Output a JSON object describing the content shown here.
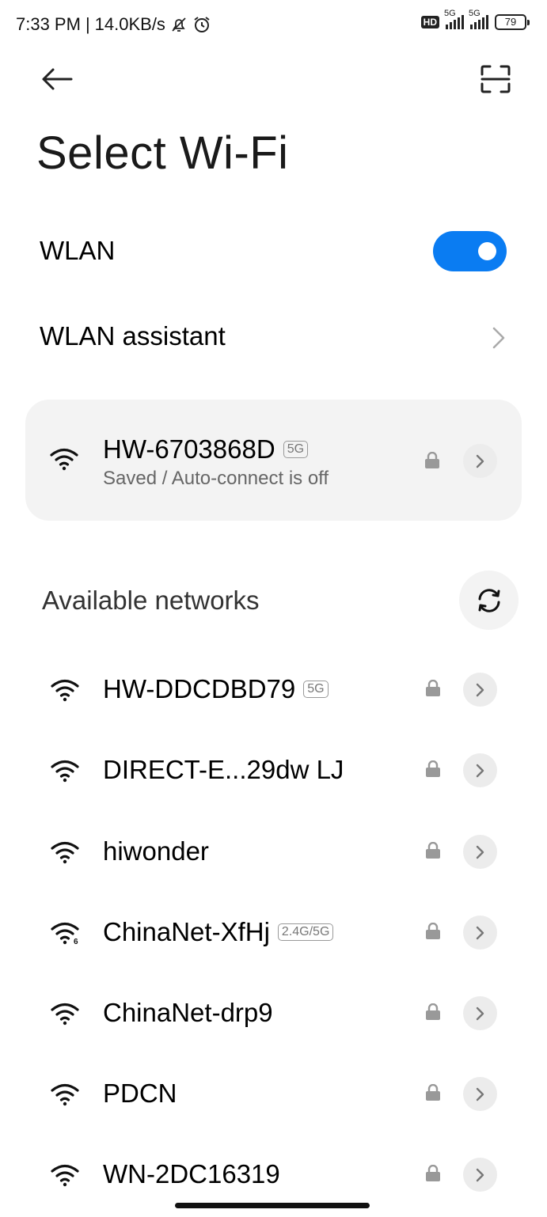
{
  "status_bar": {
    "time": "7:33 PM",
    "speed": "14.0KB/s",
    "hd_label": "HD",
    "sim1_tag": "5G",
    "sim2_tag": "5G",
    "battery": "79"
  },
  "header": {
    "title": "Select Wi-Fi",
    "back_icon": "arrow-left-icon",
    "scan_icon": "scan-qr-icon"
  },
  "wlan": {
    "label": "WLAN",
    "enabled": true,
    "accent_color": "#0a7cf2"
  },
  "assistant": {
    "label": "WLAN assistant"
  },
  "saved_network": {
    "ssid": "HW-6703868D",
    "band": "5G",
    "status": "Saved / Auto-connect is off"
  },
  "available": {
    "label": "Available networks",
    "networks": [
      {
        "ssid": "HW-DDCDBD79",
        "band": "5G",
        "wifi6": false
      },
      {
        "ssid": "DIRECT-E...29dw LJ",
        "band": "",
        "wifi6": false
      },
      {
        "ssid": "hiwonder",
        "band": "",
        "wifi6": false
      },
      {
        "ssid": "ChinaNet-XfHj",
        "band": "2.4G/5G",
        "wifi6": true
      },
      {
        "ssid": "ChinaNet-drp9",
        "band": "",
        "wifi6": false
      },
      {
        "ssid": "PDCN",
        "band": "",
        "wifi6": false
      },
      {
        "ssid": "WN-2DC16319",
        "band": "",
        "wifi6": false
      }
    ]
  }
}
